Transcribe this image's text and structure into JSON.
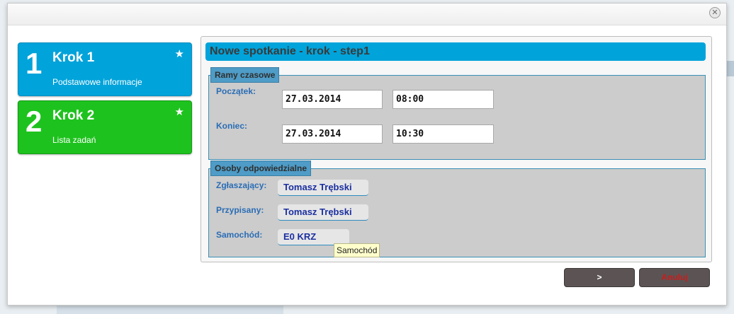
{
  "dialog": {
    "close_icon": "close-circle-icon"
  },
  "steps": [
    {
      "number": "1",
      "title": "Krok 1",
      "description": "Podstawowe informacje",
      "icon": "star-icon",
      "color": "#00a3da"
    },
    {
      "number": "2",
      "title": "Krok 2",
      "description": "Lista zadań",
      "icon": "star-icon",
      "color": "#1ec21e"
    }
  ],
  "panel": {
    "title": "Nowe spotkanie - krok - step1",
    "time_section": {
      "legend": "Ramy czasowe",
      "start": {
        "label": "Początek:",
        "date": "27.03.2014",
        "time": "08:00"
      },
      "end": {
        "label": "Koniec:",
        "date": "27.03.2014",
        "time": "10:30"
      }
    },
    "people_section": {
      "legend": "Osoby odpowiedzialne",
      "reporter": {
        "label": "Zgłaszający:",
        "value": "Tomasz Trębski"
      },
      "assignee": {
        "label": "Przypisany:",
        "value": "Tomasz Trębski"
      },
      "car": {
        "label": "Samochód:",
        "value": "E0 KRZ"
      }
    },
    "tooltip": "Samochód"
  },
  "buttons": {
    "next": ">",
    "cancel": "Anuluj"
  }
}
